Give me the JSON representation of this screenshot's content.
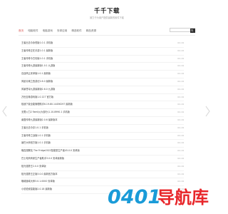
{
  "site": {
    "title": "千千下载",
    "subtitle": "致力于为用户提供最新的软件下载"
  },
  "nav": {
    "items": [
      {
        "label": "首页",
        "active": true
      },
      {
        "label": "电脑软件",
        "active": false
      },
      {
        "label": "电脑游戏",
        "active": false
      },
      {
        "label": "安卓应用",
        "active": false
      },
      {
        "label": "精选软件",
        "active": false
      },
      {
        "label": "精品资源",
        "active": false
      }
    ],
    "search_placeholder": ""
  },
  "articles": [
    {
      "title": "王者出击今永恒版1.0.1 手机版",
      "date": "02-19"
    },
    {
      "title": "王者传奇正在手游1.0.1 最新版",
      "date": "02-19"
    },
    {
      "title": "王者传奇今古世版1.0.1 手机版",
      "date": "02-19"
    },
    {
      "title": "王者传奇九游最新版1.0.1 九游版",
      "date": "02-19"
    },
    {
      "title": "百战风云安卓版1.0.1 最新版",
      "date": "02-19"
    },
    {
      "title": "风起青城之西游记2.6.0 最新版",
      "date": "02-19"
    },
    {
      "title": "风暴苍穹九游最新版2.6.0 九游版",
      "date": "02-19"
    },
    {
      "title": "万世至尊游戏版1.0.127 官方版",
      "date": "02-19"
    },
    {
      "title": "极速下载全能管理助手6.19.80.14456297 最新版",
      "date": "02-19"
    },
    {
      "title": "无限火力2 Family(大部分)1.10.8990.1 手机版",
      "date": "02-19"
    },
    {
      "title": "秦国传奇九游最新版2.0.6 最新版本",
      "date": "02-19"
    },
    {
      "title": "王者出击今京1.0.1 手机版",
      "date": "02-19"
    },
    {
      "title": "王者传奇之战版1.0.1 手机版",
      "date": "02-19"
    },
    {
      "title": "暴巴大师官方版1.0.1 手机版",
      "date": "02-19"
    },
    {
      "title": "晚霞观察站 The Fridge2022智能型生产者45.0.0 安卓版",
      "date": "02-19"
    },
    {
      "title": "巴士电商商家生产者助手3.0.0 安卓最新版",
      "date": "02-19"
    },
    {
      "title": "极光强势王2.0.0 安卓版",
      "date": "02-19"
    },
    {
      "title": "极光强势王正版3.0.0 最新官方版本",
      "date": "02-19"
    },
    {
      "title": "晚城魔域大师3.0.1.0000 安卓版",
      "date": "02-19"
    },
    {
      "title": "小说检索智能版2.0.18 最新版",
      "date": "02-19"
    }
  ],
  "icons": {
    "search": "search-icon",
    "prev": "chevron-left-icon",
    "next": "chevron-right-icon"
  },
  "colors": {
    "nav_active": "#d9534f",
    "watermark_digits": "#1a9bd8",
    "watermark_text": "#e8262a"
  },
  "watermark": {
    "digits": "0401",
    "text": "导航库"
  }
}
